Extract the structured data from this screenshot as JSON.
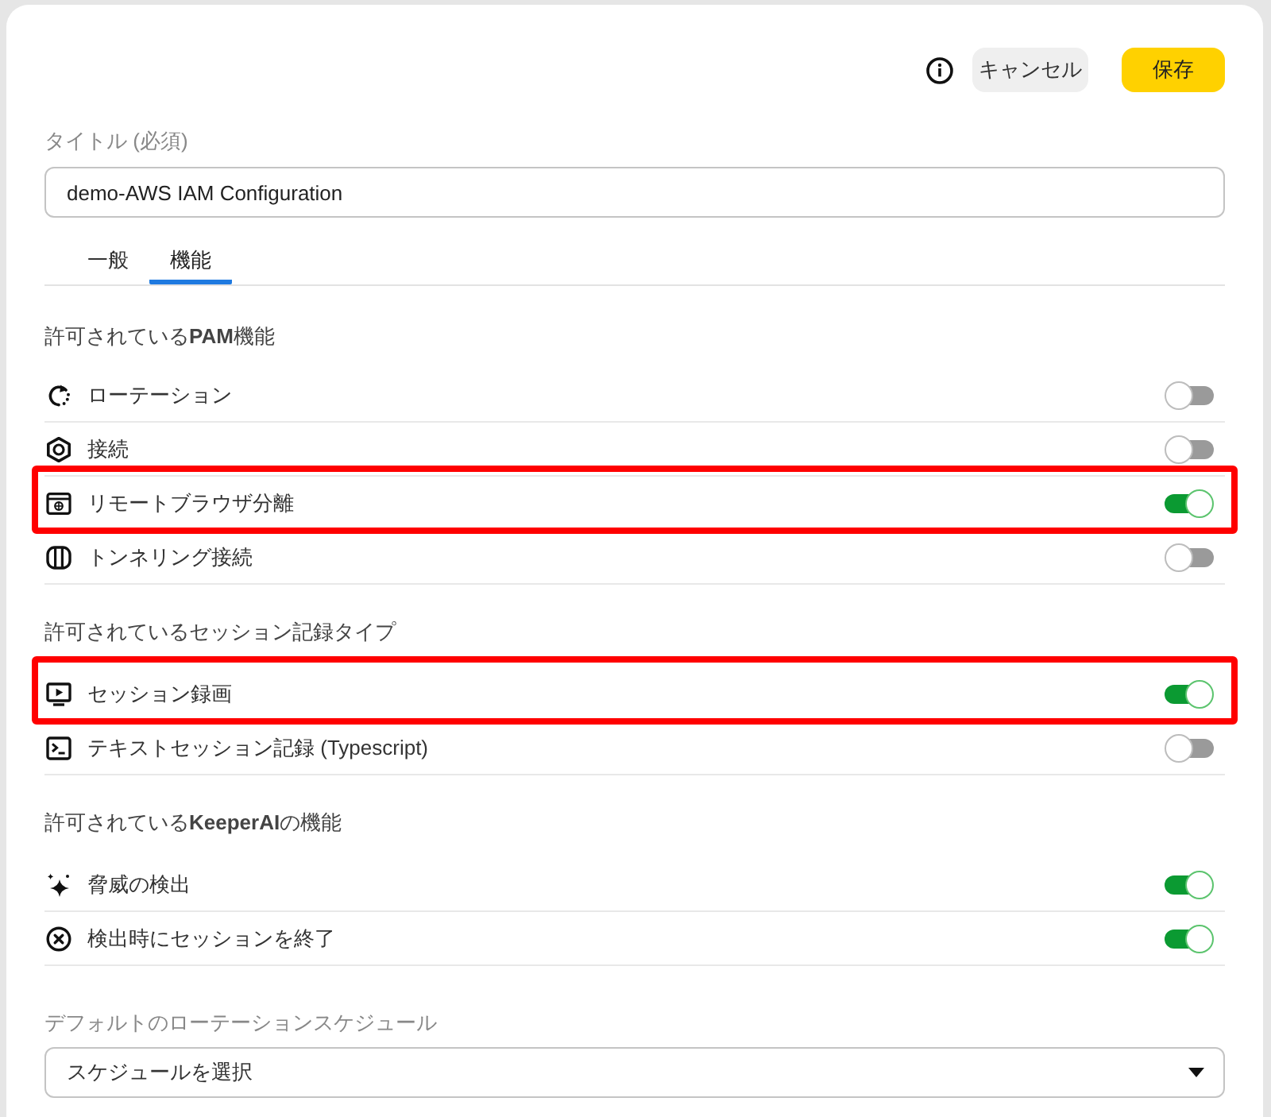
{
  "buttons": [
    {
      "label": "キャンセル",
      "kind": "secondary"
    },
    {
      "label": "保存",
      "kind": "primary"
    }
  ],
  "title_field": {
    "label": "タイトル (必須)",
    "value": "demo-AWS IAM Configuration"
  },
  "tabs": [
    {
      "label": "一般",
      "selected": false
    },
    {
      "label": "機能",
      "selected": true
    }
  ],
  "sections": [
    {
      "heading": "許可されている**PAM**機能",
      "items": [
        {
          "label": "ローテーション",
          "on": false,
          "highlighted": false
        },
        {
          "label": "接続",
          "on": false,
          "highlighted": false
        },
        {
          "label": "リモートブラウザ分離",
          "on": true,
          "highlighted": true
        },
        {
          "label": "トンネリング接続",
          "on": false,
          "highlighted": false
        }
      ]
    },
    {
      "heading": "許可されているセッション記録タイプ",
      "items": [
        {
          "label": "セッション録画",
          "on": true,
          "highlighted": true
        },
        {
          "label": "テキストセッション記録 (Typescript)",
          "on": false,
          "highlighted": false
        }
      ]
    },
    {
      "heading": "許可されている**KeeperAI**の機能",
      "items": [
        {
          "label": "脅威の検出",
          "on": true,
          "highlighted": false
        },
        {
          "label": "検出時にセッションを終了",
          "on": true,
          "highlighted": false
        }
      ]
    }
  ],
  "schedule_field": {
    "label": "デフォルトのローテーションスケジュール",
    "placeholder": "スケジュールを選択"
  }
}
